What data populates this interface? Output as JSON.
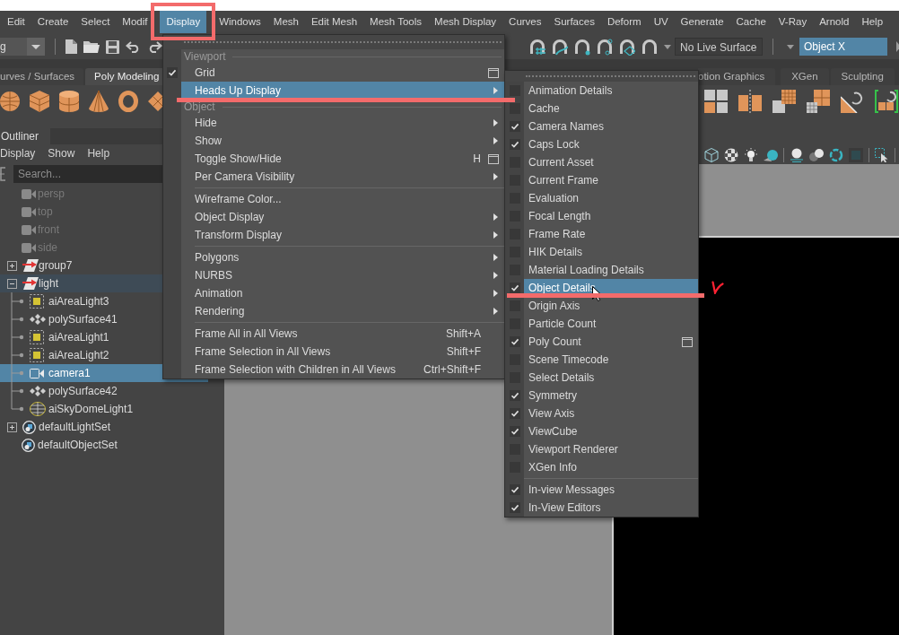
{
  "menu_bar": {
    "items": [
      {
        "label": "Edit",
        "selected": false
      },
      {
        "label": "Create",
        "selected": false
      },
      {
        "label": "Select",
        "selected": false
      },
      {
        "label": "Modif",
        "selected": false
      },
      {
        "label": "Display",
        "selected": true,
        "framed": true
      },
      {
        "label": "Windows",
        "selected": false
      },
      {
        "label": "Mesh",
        "selected": false
      },
      {
        "label": "Edit Mesh",
        "selected": false
      },
      {
        "label": "Mesh Tools",
        "selected": false
      },
      {
        "label": "Mesh Display",
        "selected": false
      },
      {
        "label": "Curves",
        "selected": false
      },
      {
        "label": "Surfaces",
        "selected": false
      },
      {
        "label": "Deform",
        "selected": false
      },
      {
        "label": "UV",
        "selected": false
      },
      {
        "label": "Generate",
        "selected": false
      },
      {
        "label": "Cache",
        "selected": false
      },
      {
        "label": "V-Ray",
        "selected": false
      },
      {
        "label": "Arnold",
        "selected": false
      },
      {
        "label": "Help",
        "selected": false
      }
    ]
  },
  "status_line": {
    "workspace_dropdown": {
      "value": "g"
    },
    "live_surface_field": {
      "value": "No Live Surface"
    },
    "axis_field": {
      "value": "Object X"
    }
  },
  "shelf": {
    "tab_groups": [
      [
        {
          "label": "urves / Surfaces",
          "selected": false
        },
        {
          "label": "Poly Modeling",
          "selected": true
        }
      ],
      [
        {
          "label": "otion Graphics",
          "selected": false
        },
        {
          "label": "XGen",
          "selected": false
        },
        {
          "label": "Sculpting",
          "selected": false
        }
      ]
    ]
  },
  "outliner": {
    "title": "Outliner",
    "menu": [
      "Display",
      "Show",
      "Help"
    ],
    "search": {
      "placeholder": "Search..."
    },
    "items": [
      {
        "label": "persp",
        "kind": "camera",
        "dimmed": true,
        "highlighted": false,
        "selected": false
      },
      {
        "label": "top",
        "kind": "camera",
        "dimmed": true,
        "highlighted": false,
        "selected": false
      },
      {
        "label": "front",
        "kind": "camera",
        "dimmed": true,
        "highlighted": false,
        "selected": false
      },
      {
        "label": "side",
        "kind": "camera",
        "dimmed": true,
        "highlighted": false,
        "selected": false
      },
      {
        "label": "group7",
        "kind": "group",
        "expanded": false,
        "dimmed": false,
        "highlighted": false,
        "selected": false
      },
      {
        "label": "light",
        "kind": "group",
        "expanded": true,
        "dimmed": false,
        "highlighted": true,
        "selected": false,
        "children": [
          {
            "label": "aiAreaLight3",
            "kind": "area_light",
            "dimmed": false,
            "highlighted": false,
            "selected": false
          },
          {
            "label": "polySurface41",
            "kind": "mesh",
            "dimmed": false,
            "highlighted": false,
            "selected": false
          },
          {
            "label": "aiAreaLight1",
            "kind": "area_light",
            "dimmed": false,
            "highlighted": false,
            "selected": false
          },
          {
            "label": "aiAreaLight2",
            "kind": "area_light",
            "dimmed": false,
            "highlighted": false,
            "selected": false
          },
          {
            "label": "camera1",
            "kind": "camera",
            "dimmed": false,
            "highlighted": false,
            "selected": true
          },
          {
            "label": "polySurface42",
            "kind": "mesh",
            "dimmed": false,
            "highlighted": false,
            "selected": false
          },
          {
            "label": "aiSkyDomeLight1",
            "kind": "sky_light",
            "dimmed": false,
            "highlighted": false,
            "selected": false
          }
        ]
      },
      {
        "label": "defaultLightSet",
        "kind": "set",
        "expanded": false,
        "dimmed": false,
        "highlighted": false,
        "selected": false
      },
      {
        "label": "defaultObjectSet",
        "kind": "set",
        "dimmed": false,
        "highlighted": false,
        "selected": false
      }
    ]
  },
  "display_menu": {
    "sections": [
      {
        "title": "Viewport",
        "groups": [
          [
            {
              "label": "Grid",
              "kind": "command",
              "checked": true,
              "option_box": true,
              "selected": false
            },
            {
              "label": "Heads Up Display",
              "kind": "submenu",
              "checked": false,
              "selected": true,
              "underlined": true
            }
          ]
        ]
      },
      {
        "title": "Object",
        "groups": [
          [
            {
              "label": "Hide",
              "kind": "submenu",
              "checked": false,
              "selected": false
            },
            {
              "label": "Show",
              "kind": "submenu",
              "checked": false,
              "selected": false
            },
            {
              "label": "Toggle Show/Hide",
              "kind": "command",
              "shortcut": "H",
              "option_box": true,
              "checked": false,
              "selected": false
            },
            {
              "label": "Per Camera Visibility",
              "kind": "submenu",
              "checked": false,
              "selected": false
            }
          ],
          [
            {
              "label": "Wireframe Color...",
              "kind": "command",
              "checked": false,
              "selected": false
            },
            {
              "label": "Object Display",
              "kind": "submenu",
              "checked": false,
              "selected": false
            },
            {
              "label": "Transform Display",
              "kind": "submenu",
              "checked": false,
              "selected": false
            }
          ],
          [
            {
              "label": "Polygons",
              "kind": "submenu",
              "checked": false,
              "selected": false
            },
            {
              "label": "NURBS",
              "kind": "submenu",
              "checked": false,
              "selected": false
            },
            {
              "label": "Animation",
              "kind": "submenu",
              "checked": false,
              "selected": false
            },
            {
              "label": "Rendering",
              "kind": "submenu",
              "checked": false,
              "selected": false
            }
          ],
          [
            {
              "label": "Frame All in All Views",
              "kind": "command",
              "shortcut": "Shift+A",
              "checked": false,
              "selected": false
            },
            {
              "label": "Frame Selection in All Views",
              "kind": "command",
              "shortcut": "Shift+F",
              "checked": false,
              "selected": false
            },
            {
              "label": "Frame Selection with Children in All Views",
              "kind": "command",
              "shortcut": "Ctrl+Shift+F",
              "checked": false,
              "selected": false
            }
          ]
        ]
      }
    ]
  },
  "hud_submenu": {
    "groups": [
      [
        {
          "label": "Animation Details",
          "checked": false,
          "selected": false
        },
        {
          "label": "Cache",
          "checked": false,
          "selected": false
        },
        {
          "label": "Camera Names",
          "checked": true,
          "selected": false
        },
        {
          "label": "Caps Lock",
          "checked": true,
          "selected": false
        },
        {
          "label": "Current Asset",
          "checked": false,
          "selected": false
        },
        {
          "label": "Current Frame",
          "checked": false,
          "selected": false
        },
        {
          "label": "Evaluation",
          "checked": false,
          "selected": false
        },
        {
          "label": "Focal Length",
          "checked": false,
          "selected": false
        },
        {
          "label": "Frame Rate",
          "checked": false,
          "selected": false
        },
        {
          "label": "HIK Details",
          "checked": false,
          "selected": false
        },
        {
          "label": "Material Loading Details",
          "checked": false,
          "selected": false
        },
        {
          "label": "Object Details",
          "checked": true,
          "selected": true,
          "underlined": true,
          "ticked": true
        },
        {
          "label": "Origin Axis",
          "checked": false,
          "selected": false
        },
        {
          "label": "Particle Count",
          "checked": false,
          "selected": false
        },
        {
          "label": "Poly Count",
          "checked": true,
          "option_box": true,
          "selected": false
        },
        {
          "label": "Scene Timecode",
          "checked": false,
          "selected": false
        },
        {
          "label": "Select Details",
          "checked": false,
          "selected": false
        },
        {
          "label": "Symmetry",
          "checked": true,
          "selected": false
        },
        {
          "label": "View Axis",
          "checked": true,
          "selected": false
        },
        {
          "label": "ViewCube",
          "checked": true,
          "selected": false
        },
        {
          "label": "Viewport Renderer",
          "checked": false,
          "selected": false
        },
        {
          "label": "XGen Info",
          "checked": false,
          "selected": false
        }
      ],
      [
        {
          "label": "In-view Messages",
          "checked": true,
          "selected": false
        },
        {
          "label": "In-View Editors",
          "checked": true,
          "selected": false
        }
      ]
    ]
  }
}
